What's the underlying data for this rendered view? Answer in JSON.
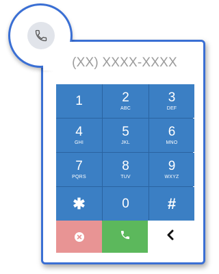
{
  "display": {
    "placeholder": "(XX) XXXX-XXXX"
  },
  "icons": {
    "header": "phone-icon",
    "clear": "clear-x-icon",
    "call": "call-phone-icon",
    "back": "chevron-left-icon"
  },
  "keys": [
    {
      "digit": "1",
      "letters": ""
    },
    {
      "digit": "2",
      "letters": "ABC"
    },
    {
      "digit": "3",
      "letters": "DEF"
    },
    {
      "digit": "4",
      "letters": "GHI"
    },
    {
      "digit": "5",
      "letters": "JKL"
    },
    {
      "digit": "6",
      "letters": "MNO"
    },
    {
      "digit": "7",
      "letters": "PQRS"
    },
    {
      "digit": "8",
      "letters": "TUV"
    },
    {
      "digit": "9",
      "letters": "WXYZ"
    },
    {
      "digit": "✱",
      "letters": ""
    },
    {
      "digit": "0",
      "letters": ""
    },
    {
      "digit": "#",
      "letters": ""
    }
  ],
  "colors": {
    "accent": "#3a6fd4",
    "key_bg": "#3b7fc4",
    "clear_bg": "#e89494",
    "call_bg": "#5cb85c"
  }
}
